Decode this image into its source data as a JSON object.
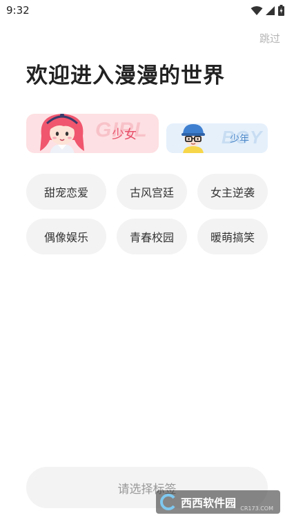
{
  "status_bar": {
    "time": "9:32"
  },
  "skip_label": "跳过",
  "title": "欢迎进入漫漫的世界",
  "gender": {
    "girl": {
      "label": "少女",
      "bg_word": "GIRL"
    },
    "boy": {
      "label": "少年",
      "bg_word": "BOY"
    }
  },
  "tags": [
    "甜宠恋爱",
    "古风宫廷",
    "女主逆袭",
    "偶像娱乐",
    "青春校园",
    "暖萌搞笑"
  ],
  "confirm_label": "请选择标签",
  "watermark": {
    "brand": "西西软件园",
    "site": "CR173.COM"
  },
  "colors": {
    "girl_accent": "#e8506a",
    "boy_accent": "#4a86c8",
    "tag_bg": "#f3f3f3"
  }
}
